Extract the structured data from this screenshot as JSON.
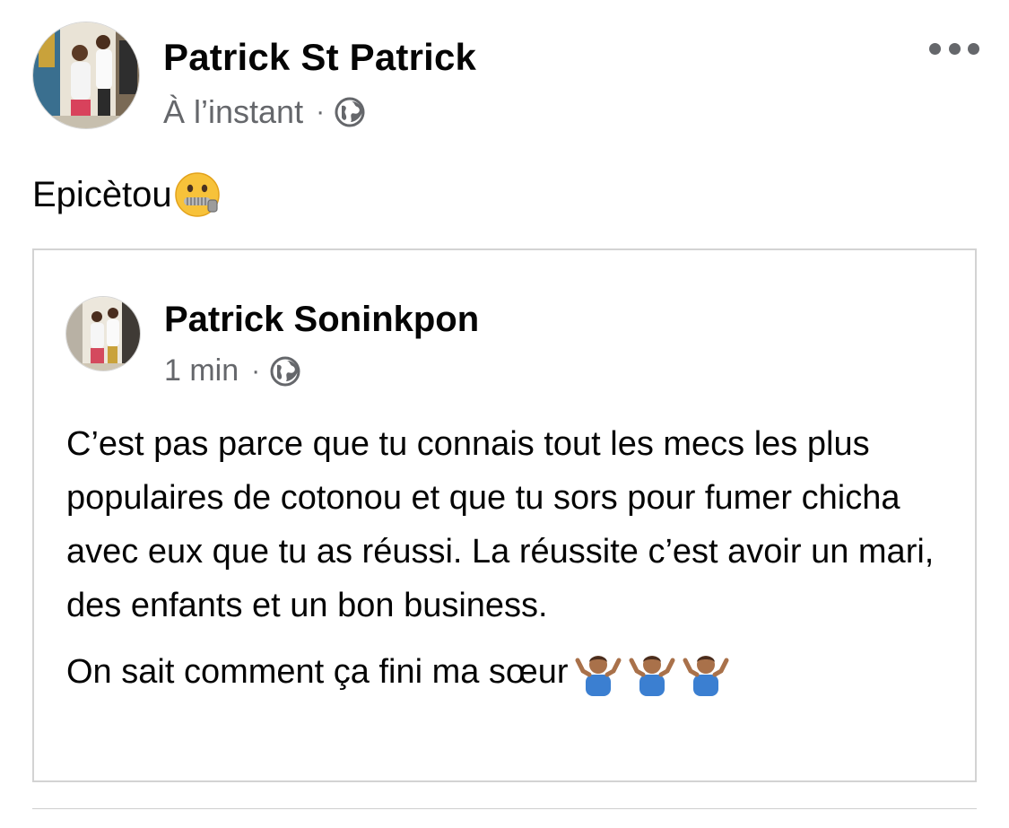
{
  "post": {
    "author": "Patrick St Patrick",
    "time": "À l’instant",
    "separator": "·",
    "privacy_icon": "globe-icon",
    "more_icon": "more-horizontal-icon",
    "caption_text": "Epicètou",
    "caption_emoji": "zipper-mouth-face-emoji"
  },
  "shared_post": {
    "author": "Patrick Soninkpon",
    "time": "1 min",
    "separator": "·",
    "privacy_icon": "globe-icon",
    "paragraph_1": "C’est pas parce que tu connais tout les mecs les plus populaires de cotonou et que tu sors pour fumer chicha avec eux que tu as réussi. La réussite c’est avoir un mari, des enfants et un bon business.",
    "paragraph_2": "On sait comment ça fini ma sœur",
    "paragraph_2_emoji": "person-shrugging-emoji",
    "paragraph_2_emoji_count": 3
  },
  "colors": {
    "text_primary": "#050505",
    "text_secondary": "#65676b",
    "border": "#d3d3d3"
  }
}
